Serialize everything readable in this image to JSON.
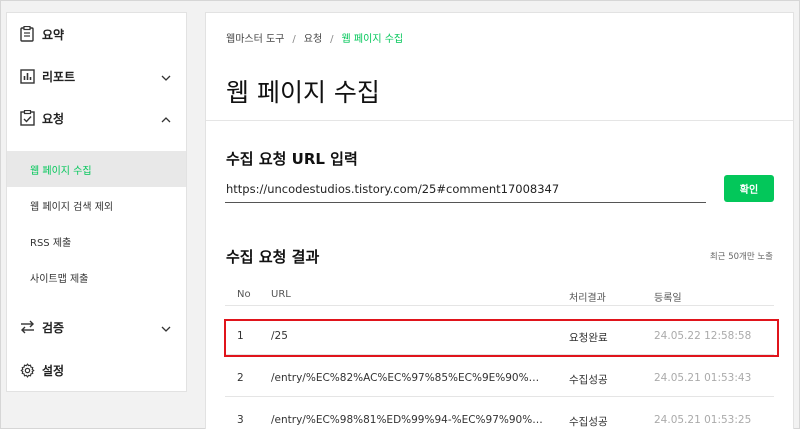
{
  "sidebar": {
    "items": [
      {
        "label": "요약",
        "icon": "summary-icon"
      },
      {
        "label": "리포트",
        "icon": "report-chart-icon",
        "expanded": false
      },
      {
        "label": "요청",
        "icon": "request-check-icon",
        "expanded": true
      },
      {
        "label": "검증",
        "icon": "verify-arrows-icon",
        "expanded": false
      },
      {
        "label": "설정",
        "icon": "gear-icon"
      }
    ],
    "sub_items": [
      {
        "label": "웹 페이지 수집",
        "active": true
      },
      {
        "label": "웹 페이지 검색 제외",
        "active": false
      },
      {
        "label": "RSS 제출",
        "active": false
      },
      {
        "label": "사이트맵 제출",
        "active": false
      }
    ]
  },
  "breadcrumb": {
    "items": [
      "웹마스터 도구",
      "요청",
      "웹 페이지 수집"
    ],
    "separator": "/"
  },
  "page_title": "웹 페이지 수집",
  "request_section": {
    "title": "수집 요청 URL 입력",
    "url_value": "https://uncodestudios.tistory.com/25#comment17008347",
    "confirm_label": "확인"
  },
  "result_section": {
    "title": "수집 요청 결과",
    "note": "최근 50개만 노출",
    "columns": [
      "No",
      "URL",
      "처리결과",
      "등록일"
    ],
    "rows": [
      {
        "no": "1",
        "url": "/25",
        "result": "요청완료",
        "date": "24.05.22 12:58:58"
      },
      {
        "no": "2",
        "url": "/entry/%EC%82%AC%EC%97%85%EC%9E%90%…",
        "result": "수집성공",
        "date": "24.05.21 01:53:43"
      },
      {
        "no": "3",
        "url": "/entry/%EC%98%81%ED%99%94-%EC%97%90%…",
        "result": "수집성공",
        "date": "24.05.21 01:53:25"
      }
    ]
  },
  "colors": {
    "accent": "#03c75a",
    "highlight": "#e0141b"
  }
}
